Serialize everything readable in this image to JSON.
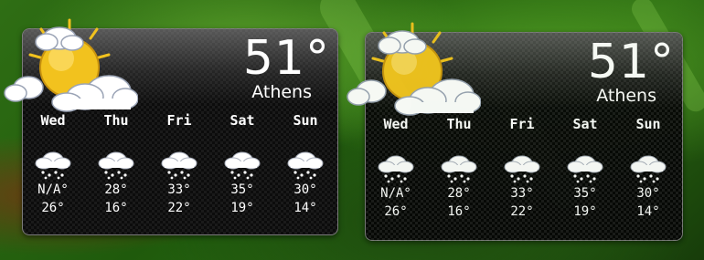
{
  "widgets": [
    {
      "temperature": "51°",
      "city": "Athens",
      "forecast": [
        {
          "day": "Wed",
          "high": "N/A°",
          "low": "26°",
          "condition": "snow-icon"
        },
        {
          "day": "Thu",
          "high": "28°",
          "low": "16°",
          "condition": "snow-icon"
        },
        {
          "day": "Fri",
          "high": "33°",
          "low": "22°",
          "condition": "snow-icon"
        },
        {
          "day": "Sat",
          "high": "35°",
          "low": "19°",
          "condition": "snow-icon"
        },
        {
          "day": "Sun",
          "high": "30°",
          "low": "14°",
          "condition": "snow-icon"
        }
      ],
      "current_condition": "partly-cloudy-icon"
    },
    {
      "temperature": "51°",
      "city": "Athens",
      "forecast": [
        {
          "day": "Wed",
          "high": "N/A°",
          "low": "26°",
          "condition": "snow-icon"
        },
        {
          "day": "Thu",
          "high": "28°",
          "low": "16°",
          "condition": "snow-icon"
        },
        {
          "day": "Fri",
          "high": "33°",
          "low": "22°",
          "condition": "snow-icon"
        },
        {
          "day": "Sat",
          "high": "35°",
          "low": "19°",
          "condition": "snow-icon"
        },
        {
          "day": "Sun",
          "high": "30°",
          "low": "14°",
          "condition": "snow-icon"
        }
      ],
      "current_condition": "partly-cloudy-icon"
    }
  ],
  "colors": {
    "text": "#ffffff",
    "sun": "#f2c21e",
    "cloud": "#ffffff",
    "background_green": "#2f6e14"
  }
}
